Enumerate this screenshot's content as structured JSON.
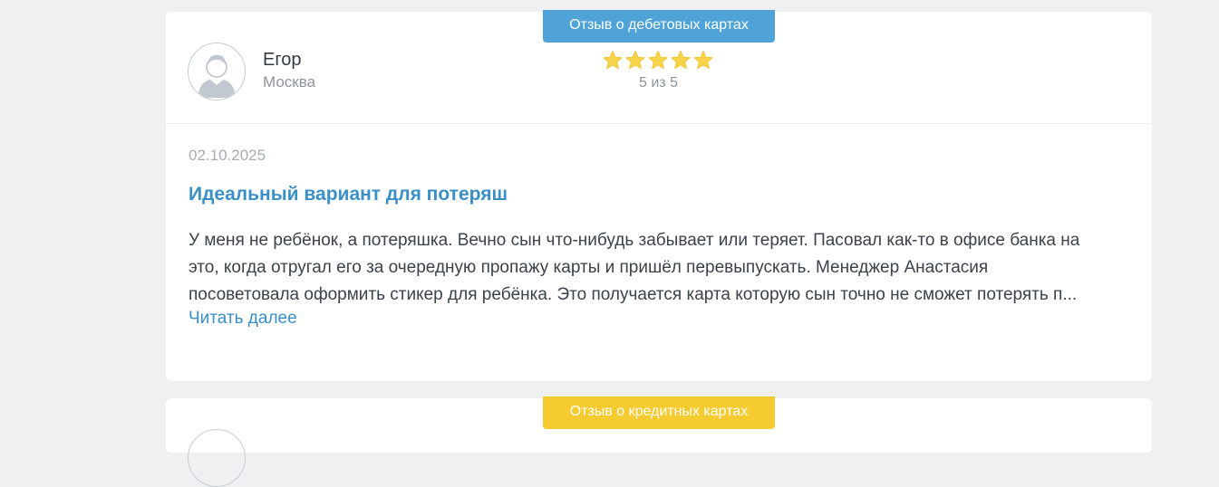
{
  "reviews": [
    {
      "category_tag": "Отзыв о дебетовых картах",
      "tag_color": "#4fa3d6",
      "author_name": "Егор",
      "author_city": "Москва",
      "rating_value": 5,
      "rating_max": 5,
      "rating_text": "5 из 5",
      "date": "02.10.2025",
      "title": "Идеальный вариант для потеряш",
      "text_lines": [
        "У меня не ребёнок, а потеряшка. Вечно сын что-нибудь забывает или теряет. Пасовал как-то в офисе банка на",
        "это, когда отругал его за очередную пропажу карты и пришёл перевыпускать. Менеджер Анастасия",
        "посоветовала оформить стикер для ребёнка. Это получается карта которую сын точно не сможет потерять п..."
      ],
      "read_more": "Читать далее",
      "avatar_icon": "user-avatar-icon"
    },
    {
      "category_tag": "Отзыв о кредитных картах",
      "tag_color": "#f5cb2f"
    }
  ],
  "colors": {
    "page_bg": "#eef0f2",
    "link": "#3a8fc6",
    "star": "#f7d44a"
  }
}
